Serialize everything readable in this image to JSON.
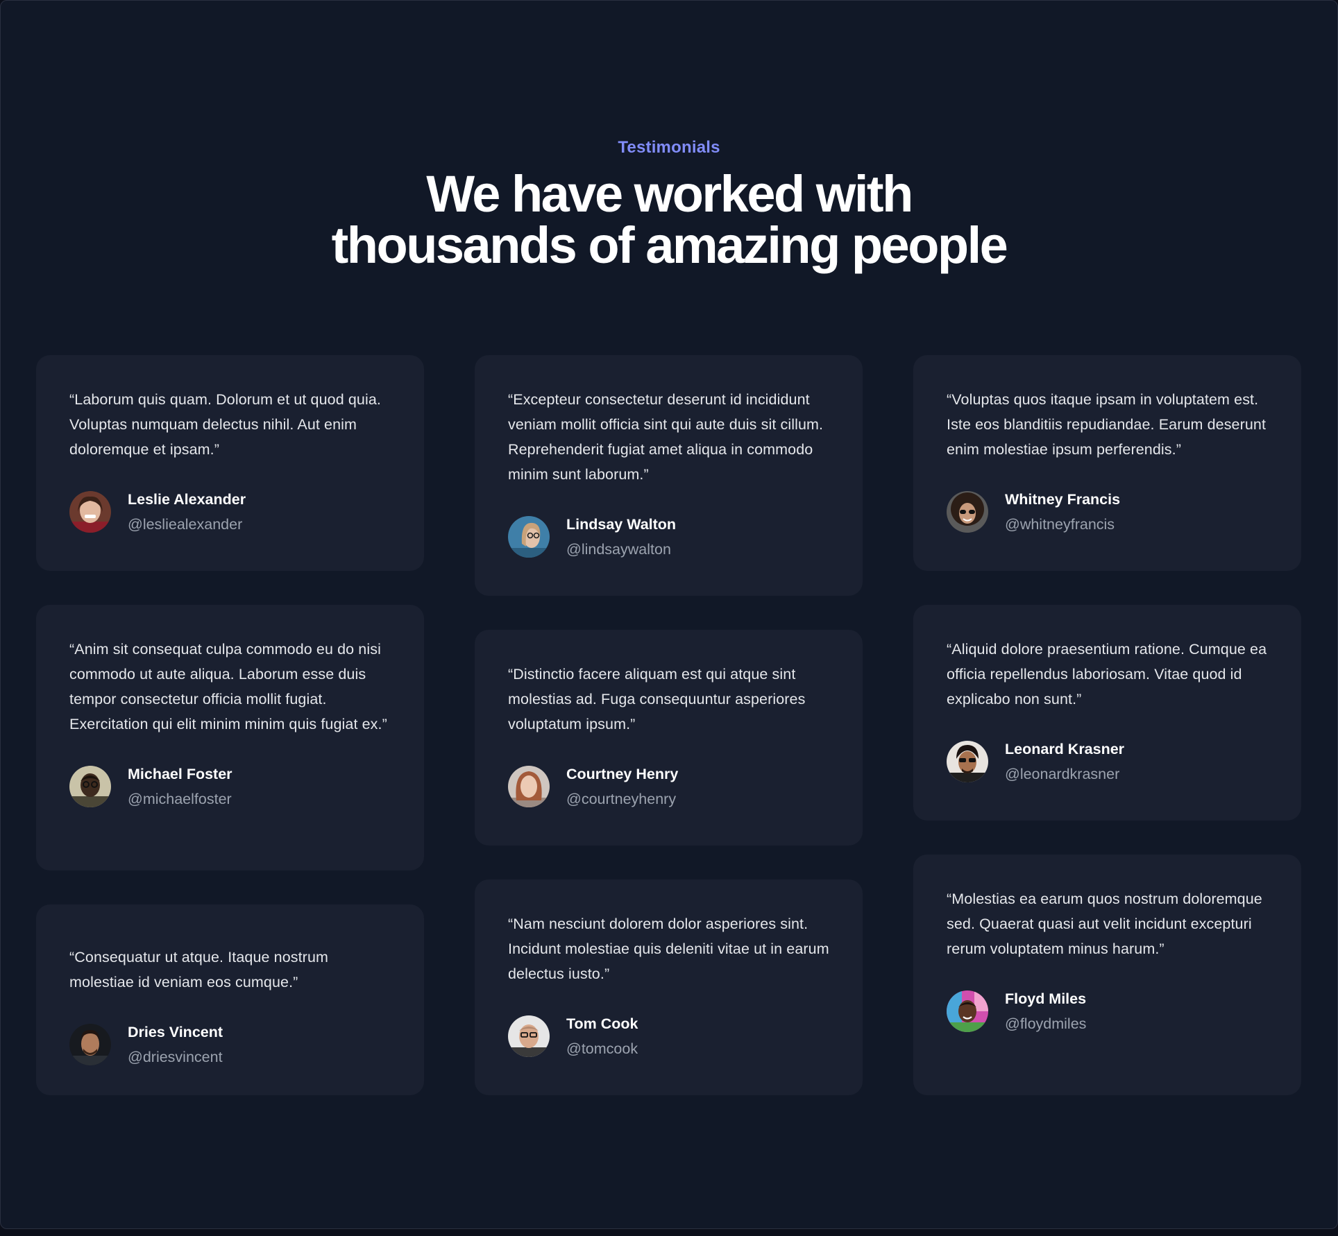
{
  "section": {
    "eyebrow": "Testimonials",
    "heading_line1": "We have worked with",
    "heading_line2": "thousands of amazing people"
  },
  "colors": {
    "background": "#111827",
    "card": "#1a2030",
    "accent": "#818cf8",
    "text": "#e5e7eb",
    "muted": "#9ca3af"
  },
  "testimonials": [
    {
      "quote": "“Laborum quis quam. Dolorum et ut quod quia. Voluptas numquam delectus nihil. Aut enim doloremque et ipsam.”",
      "name": "Leslie Alexander",
      "handle": "@lesliealexander"
    },
    {
      "quote": "“Excepteur consectetur deserunt id incididunt veniam mollit officia sint qui aute duis sit cillum. Reprehenderit fugiat amet aliqua in commodo minim sunt laborum.”",
      "name": "Lindsay Walton",
      "handle": "@lindsaywalton"
    },
    {
      "quote": "“Voluptas quos itaque ipsam in voluptatem est. Iste eos blanditiis repudiandae. Earum deserunt enim molestiae ipsum perferendis.”",
      "name": "Whitney Francis",
      "handle": "@whitneyfrancis"
    },
    {
      "quote": "“Anim sit consequat culpa commodo eu do nisi commodo ut aute aliqua. Laborum esse duis tempor consectetur officia mollit fugiat. Exercitation qui elit minim minim quis fugiat ex.”",
      "name": "Michael Foster",
      "handle": "@michaelfoster"
    },
    {
      "quote": "“Distinctio facere aliquam est qui atque sint molestias ad. Fuga consequuntur asperiores voluptatum ipsum.”",
      "name": "Courtney Henry",
      "handle": "@courtneyhenry"
    },
    {
      "quote": "“Aliquid dolore praesentium ratione. Cumque ea officia repellendus laboriosam. Vitae quod id explicabo non sunt.”",
      "name": "Leonard Krasner",
      "handle": "@leonardkrasner"
    },
    {
      "quote": "“Consequatur ut atque. Itaque nostrum molestiae id veniam eos cumque.”",
      "name": "Dries Vincent",
      "handle": "@driesvincent"
    },
    {
      "quote": "“Nam nesciunt dolorem dolor asperiores sint. Incidunt molestiae quis deleniti vitae ut in earum delectus iusto.”",
      "name": "Tom Cook",
      "handle": "@tomcook"
    },
    {
      "quote": "“Molestias ea earum quos nostrum doloremque sed. Quaerat quasi aut velit incidunt excepturi rerum voluptatem minus harum.”",
      "name": "Floyd Miles",
      "handle": "@floydmiles"
    }
  ]
}
